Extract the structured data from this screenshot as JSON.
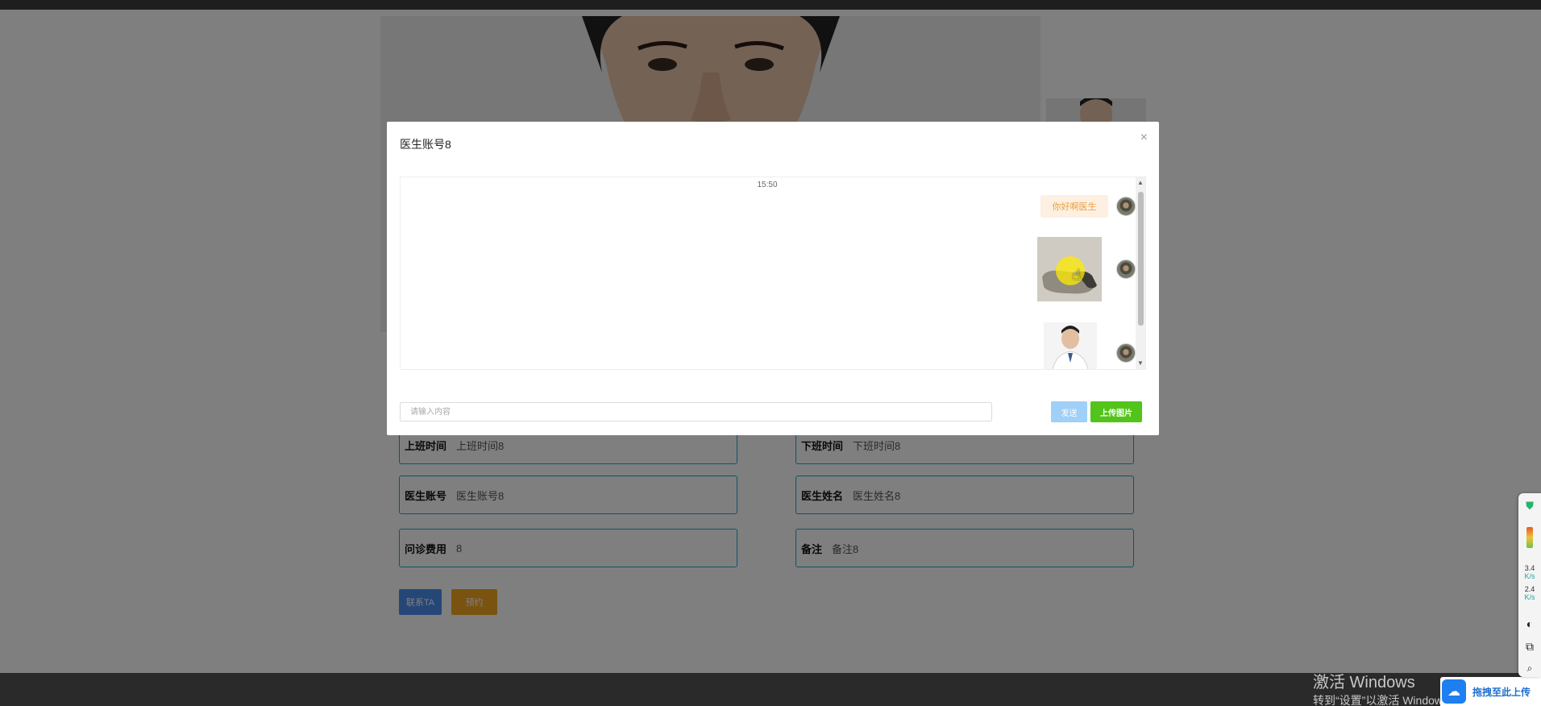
{
  "modal": {
    "title": "医生账号8",
    "close_glyph": "×"
  },
  "chat": {
    "timestamp": "15:50",
    "messages": [
      {
        "type": "text",
        "content": "你好啊医生",
        "side": "right"
      },
      {
        "type": "image",
        "side": "right"
      },
      {
        "type": "image",
        "side": "right"
      }
    ],
    "input_placeholder": "请输入内容",
    "send_label": "发送",
    "upload_label": "上传图片"
  },
  "doctor_fields": [
    {
      "label": "上班时间",
      "value": "上班时间8"
    },
    {
      "label": "下班时间",
      "value": "下班时间8"
    },
    {
      "label": "医生账号",
      "value": "医生账号8"
    },
    {
      "label": "医生姓名",
      "value": "医生姓名8"
    },
    {
      "label": "问诊费用",
      "value": "8"
    },
    {
      "label": "备注",
      "value": "备注8"
    }
  ],
  "actions": {
    "contact_label": "联系TA",
    "book_label": "预约"
  },
  "watermark": {
    "title": "激活 Windows",
    "subtitle": "转到“设置”以激活 Windows。"
  },
  "upload_drop": {
    "label": "拖拽至此上传",
    "icon": "cloud-upload-icon"
  },
  "side_widget": {
    "upload_speed": "3.4",
    "upload_unit": "K/s",
    "download_speed": "2.4",
    "download_unit": "K/s"
  },
  "colors": {
    "field_border": "#1ba6d8",
    "contact_button": "#4a8ff0",
    "book_button": "#f5a623",
    "send_button": "#a0cff7",
    "upload_button": "#52c41a",
    "bubble_bg": "#fdf0e2",
    "bubble_text": "#e8a040"
  }
}
